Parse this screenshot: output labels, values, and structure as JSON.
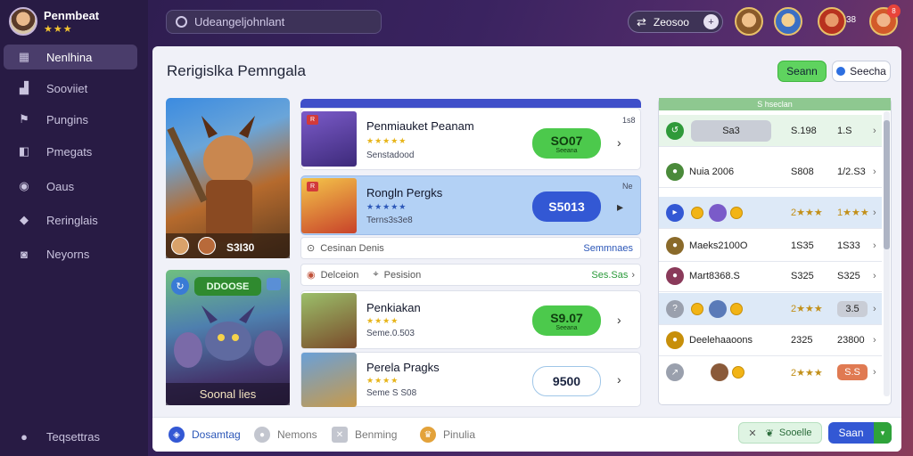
{
  "profile": {
    "name": "Penmbeat",
    "stars": "★★★"
  },
  "search": {
    "placeholder": "Udeangeljohnlant"
  },
  "sidebar": {
    "items": [
      {
        "label": "Nenlhina",
        "icon": "grid-icon",
        "glyph": "▦"
      },
      {
        "label": "Sooviiet",
        "icon": "chart-icon",
        "glyph": "▟"
      },
      {
        "label": "Pungins",
        "icon": "tag-icon",
        "glyph": "⚑"
      },
      {
        "label": "Pmegats",
        "icon": "box-icon",
        "glyph": "◧"
      },
      {
        "label": "Oaus",
        "icon": "circle-icon",
        "glyph": "◉"
      },
      {
        "label": "Reringlais",
        "icon": "diamond-icon",
        "glyph": "◆"
      },
      {
        "label": "Neyorns",
        "icon": "camera-icon",
        "glyph": "◙"
      }
    ],
    "footer": {
      "label": "Teqsettras",
      "icon": "settings-icon",
      "glyph": "●"
    }
  },
  "topbar": {
    "coins": "Zeosoo",
    "badge": "38",
    "notifications": "8"
  },
  "main": {
    "title": "Rerigislka Pemngala",
    "btn_green": "Seann",
    "btn_search": "Seecha"
  },
  "featured": [
    {
      "value": "S3I30"
    },
    {
      "pill": "DDOOSE",
      "label": "Soonal lies"
    }
  ],
  "list": [
    {
      "title": "Penmiauket Peanam",
      "stars": "★★★★★",
      "sub": "Senstadood",
      "price": "SO07",
      "price_sub": "Seeana",
      "corner": "1s8"
    },
    {
      "title": "Rongln Pergks",
      "stars": "★★★★★",
      "sub": "Terns3s3e8",
      "price": "S5013",
      "corner": "Ne"
    },
    {
      "title": "Penkiakan",
      "stars": "★★★★",
      "sub": "Seme.0.503",
      "price": "S9.07",
      "price_sub": "Seeana"
    },
    {
      "title": "Perela Pragks",
      "stars": "★★★★",
      "sub": "Seme S S08",
      "price": "9500"
    }
  ],
  "info_rows": [
    {
      "left": "Cesinan Denis",
      "right": "Semmnaes"
    },
    {
      "left": "Delceion",
      "middle": "Pesision",
      "right": "Ses.Sas"
    }
  ],
  "table": {
    "header": "S hseclan",
    "rows": [
      {
        "name": "Sa3",
        "v1": "S.198",
        "v2": "1.S"
      },
      {
        "name": "Nuia 2006",
        "v1": "S808",
        "v2": "1/2.S3"
      },
      {
        "name": "",
        "v1": "2★★★",
        "v2": "1★★★"
      },
      {
        "name": "Maeks2100O",
        "v1": "1S35",
        "v2": "1S33"
      },
      {
        "name": "Mart8368.S",
        "v1": "S325",
        "v2": "S325"
      },
      {
        "name": "",
        "v1": "2★★★",
        "v2": "3.5"
      },
      {
        "name": "Deelehaaoons",
        "v1": "2325",
        "v2": "23800"
      },
      {
        "name": "",
        "v1": "2★★★",
        "v2": "S.S"
      }
    ]
  },
  "bottom": {
    "tabs": [
      "Dosamtag",
      "Nemons",
      "Benming",
      "Pinulia"
    ],
    "schedule": "Sooelle",
    "save": "Saan"
  },
  "colors": {
    "accent": "#3358d4",
    "green": "#5fd35f",
    "sidebar": "#281b44"
  }
}
